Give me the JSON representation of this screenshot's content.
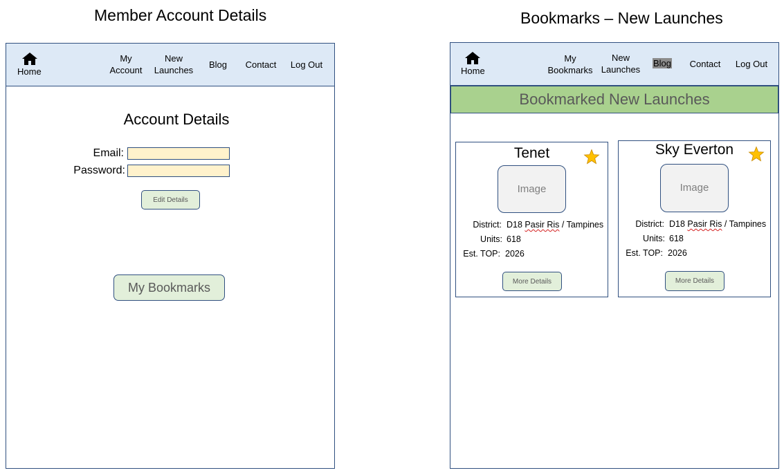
{
  "left_mockup": {
    "title": "Member Account Details",
    "nav": {
      "home_label": "Home",
      "items": [
        {
          "line1": "My",
          "line2": "Account"
        },
        {
          "line1": "New",
          "line2": "Launches"
        },
        {
          "line1": "Blog",
          "line2": ""
        },
        {
          "line1": "Contact",
          "line2": ""
        },
        {
          "line1": "Log Out",
          "line2": ""
        }
      ]
    },
    "heading": "Account Details",
    "email_label": "Email:",
    "email_value": "",
    "password_label": "Password:",
    "password_value": "",
    "edit_button": "Edit Details",
    "bookmarks_button": "My Bookmarks"
  },
  "right_mockup": {
    "title": "Bookmarks – New Launches",
    "nav": {
      "home_label": "Home",
      "items": [
        {
          "line1": "My",
          "line2": "Bookmarks"
        },
        {
          "line1": "New",
          "line2": "Launches"
        },
        {
          "line1": "Blog",
          "line2": ""
        },
        {
          "line1": "Contact",
          "line2": ""
        },
        {
          "line1": "Log Out",
          "line2": ""
        }
      ]
    },
    "banner": "Bookmarked New Launches",
    "cards": [
      {
        "name": "Tenet",
        "image_label": "Image",
        "district_label": "District:",
        "district_code": "D18",
        "district_area": "Pasir Ris",
        "district_rest": "/ Tampines",
        "units_label": "Units:",
        "units_value": "618",
        "top_label": "Est. TOP:",
        "top_value": "2026",
        "button": "More Details"
      },
      {
        "name": "Sky Everton",
        "image_label": "Image",
        "district_label": "District:",
        "district_code": "D18",
        "district_area": "Pasir Ris",
        "district_rest": "/ Tampines",
        "units_label": "Units:",
        "units_value": "618",
        "top_label": "Est. TOP:",
        "top_value": "2026",
        "button": "More Details"
      }
    ]
  },
  "colors": {
    "nav_bg": "#dde9f6",
    "border": "#2f4f7f",
    "input_bg": "#fff2cc",
    "button_bg": "#e2efda",
    "banner_bg": "#a9d18e",
    "star": "#ffc000"
  },
  "icons": {
    "home": "home-icon",
    "bookmark": "star-icon"
  }
}
